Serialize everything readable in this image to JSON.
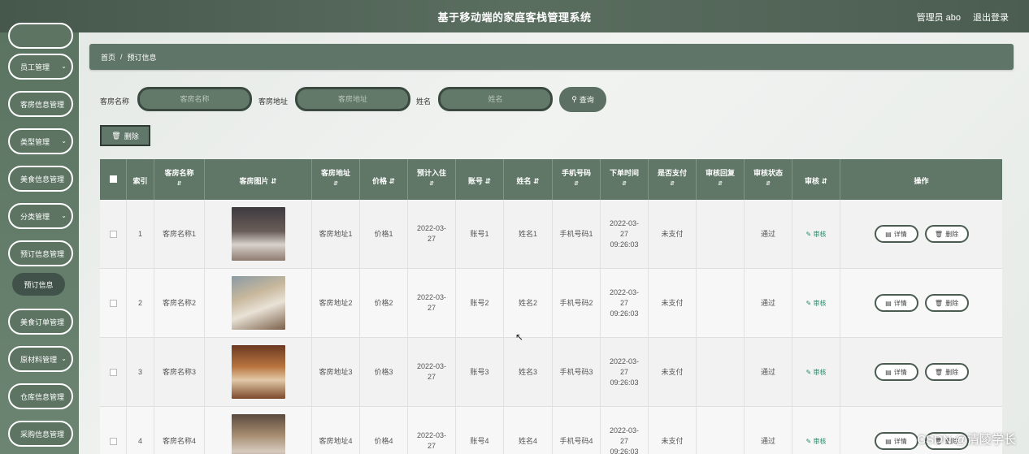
{
  "header": {
    "title": "基于移动端的家庭客栈管理系统",
    "user": "管理员 abo",
    "logout": "退出登录"
  },
  "sidebar": {
    "items": [
      {
        "label": "员工管理",
        "chevron": true
      },
      {
        "label": "客房信息管理",
        "chevron": false
      },
      {
        "label": "类型管理",
        "chevron": true
      },
      {
        "label": "美食信息管理",
        "chevron": false
      },
      {
        "label": "分类管理",
        "chevron": true
      },
      {
        "label": "预订信息管理",
        "chevron": false
      },
      {
        "label": "美食订单管理",
        "chevron": false
      },
      {
        "label": "原材料管理",
        "chevron": true
      },
      {
        "label": "仓库信息管理",
        "chevron": false
      },
      {
        "label": "采购信息管理",
        "chevron": false
      }
    ],
    "sub_item": "预订信息"
  },
  "breadcrumb": {
    "home": "首页",
    "separator": "/",
    "current": "预订信息"
  },
  "search": {
    "room_name_label": "客房名称",
    "room_name_placeholder": "客房名称",
    "room_addr_label": "客房地址",
    "room_addr_placeholder": "客房地址",
    "name_label": "姓名",
    "name_placeholder": "姓名",
    "query_button": "查询"
  },
  "toolbar": {
    "delete_button": "删除"
  },
  "table": {
    "columns": [
      "索引",
      "客房名称",
      "客房图片",
      "客房地址",
      "价格",
      "预计入住",
      "账号",
      "姓名",
      "手机号码",
      "下单时间",
      "是否支付",
      "审核回复",
      "审核状态",
      "审核",
      "操作"
    ],
    "rows": [
      {
        "index": "1",
        "room_name": "客房名称1",
        "room_addr": "客房地址1",
        "price": "价格1",
        "checkin": "2022-03-27",
        "account": "账号1",
        "name": "姓名1",
        "phone": "手机号码1",
        "order_time": "2022-03-27 09:26:03",
        "paid": "未支付",
        "reply": "",
        "status": "通过",
        "audit": "审核"
      },
      {
        "index": "2",
        "room_name": "客房名称2",
        "room_addr": "客房地址2",
        "price": "价格2",
        "checkin": "2022-03-27",
        "account": "账号2",
        "name": "姓名2",
        "phone": "手机号码2",
        "order_time": "2022-03-27 09:26:03",
        "paid": "未支付",
        "reply": "",
        "status": "通过",
        "audit": "审核"
      },
      {
        "index": "3",
        "room_name": "客房名称3",
        "room_addr": "客房地址3",
        "price": "价格3",
        "checkin": "2022-03-27",
        "account": "账号3",
        "name": "姓名3",
        "phone": "手机号码3",
        "order_time": "2022-03-27 09:26:03",
        "paid": "未支付",
        "reply": "",
        "status": "通过",
        "audit": "审核"
      },
      {
        "index": "4",
        "room_name": "客房名称4",
        "room_addr": "客房地址4",
        "price": "价格4",
        "checkin": "2022-03-27",
        "account": "账号4",
        "name": "姓名4",
        "phone": "手机号码4",
        "order_time": "2022-03-27 09:26:03",
        "paid": "未支付",
        "reply": "",
        "status": "通过",
        "audit": "审核"
      }
    ],
    "detail_button": "详情",
    "delete_button": "删除"
  },
  "watermark": "CSDN @清陵学长"
}
